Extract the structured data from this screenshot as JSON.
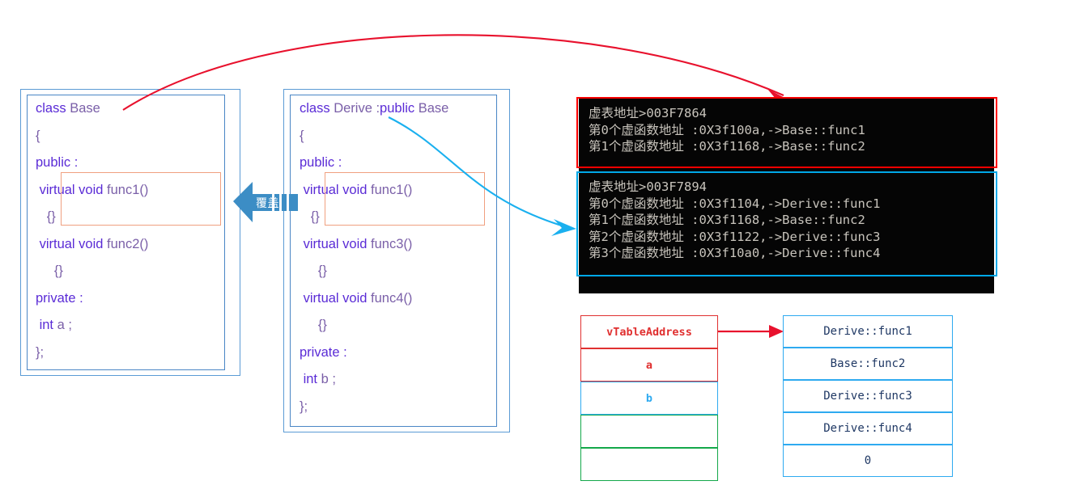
{
  "base_class": {
    "lines": [
      [
        {
          "t": "class ",
          "c": "kw"
        },
        {
          "t": "Base",
          "c": "id"
        }
      ],
      [
        {
          "t": "{",
          "c": "id"
        }
      ],
      [
        {
          "t": "public :",
          "c": "kw"
        }
      ],
      [
        {
          "t": " virtual void ",
          "c": "kw"
        },
        {
          "t": "func1()",
          "c": "id"
        }
      ],
      [
        {
          "t": "   {}",
          "c": "id"
        }
      ],
      [
        {
          "t": " virtual void ",
          "c": "kw"
        },
        {
          "t": "func2()",
          "c": "id"
        }
      ],
      [
        {
          "t": "     {}",
          "c": "id"
        }
      ],
      [
        {
          "t": "private :",
          "c": "kw"
        }
      ],
      [
        {
          "t": " int ",
          "c": "kw"
        },
        {
          "t": "a ;",
          "c": "id"
        }
      ],
      [
        {
          "t": "};",
          "c": "id"
        }
      ]
    ]
  },
  "derive_class": {
    "lines": [
      [
        {
          "t": "class ",
          "c": "kw"
        },
        {
          "t": "Derive :",
          "c": "id"
        },
        {
          "t": "public ",
          "c": "kw"
        },
        {
          "t": "Base",
          "c": "id"
        }
      ],
      [
        {
          "t": "{",
          "c": "id"
        }
      ],
      [
        {
          "t": "public :",
          "c": "kw"
        }
      ],
      [
        {
          "t": " virtual void ",
          "c": "kw"
        },
        {
          "t": "func1()",
          "c": "id"
        }
      ],
      [
        {
          "t": "   {}",
          "c": "id"
        }
      ],
      [
        {
          "t": " virtual void ",
          "c": "kw"
        },
        {
          "t": "func3()",
          "c": "id"
        }
      ],
      [
        {
          "t": "     {}",
          "c": "id"
        }
      ],
      [
        {
          "t": " virtual void ",
          "c": "kw"
        },
        {
          "t": "func4()",
          "c": "id"
        }
      ],
      [
        {
          "t": "     {}",
          "c": "id"
        }
      ],
      [
        {
          "t": "private :",
          "c": "kw"
        }
      ],
      [
        {
          "t": " int ",
          "c": "kw"
        },
        {
          "t": "b ;",
          "c": "id"
        }
      ],
      [
        {
          "t": "};",
          "c": "id"
        }
      ]
    ]
  },
  "override_arrow": {
    "label": "覆盖",
    "color": "#3c8dc5"
  },
  "console_base": {
    "border_color": "#ff0000",
    "lines": [
      "虚表地址>003F7864",
      "第0个虚函数地址 :0X3f100a,->Base::func1",
      "第1个虚函数地址 :0X3f1168,->Base::func2"
    ]
  },
  "console_derive": {
    "border_color": "#00a8e8",
    "lines": [
      "虚表地址>003F7894",
      "第0个虚函数地址 :0X3f1104,->Derive::func1",
      "第1个虚函数地址 :0X3f1168,->Base::func2",
      "第2个虚函数地址 :0X3f1122,->Derive::func3",
      "第3个虚函数地址 :0X3f10a0,->Derive::func4"
    ]
  },
  "object_layout": {
    "cells": [
      {
        "label": "vTableAddress",
        "color": "red"
      },
      {
        "label": "a",
        "color": "red"
      },
      {
        "label": "b",
        "color": "blue"
      },
      {
        "label": "",
        "color": "green"
      },
      {
        "label": "",
        "color": "green"
      }
    ]
  },
  "vtable": {
    "cells": [
      {
        "label": "Derive::func1"
      },
      {
        "label": "Base::func2"
      },
      {
        "label": "Derive::func3"
      },
      {
        "label": "Derive::func4"
      },
      {
        "label": "0"
      }
    ]
  },
  "colors": {
    "keyword": "#5a2bd6",
    "identifier": "#7a5fa8",
    "box_border": "#5b9bd5",
    "highlight": "#f0a080",
    "red_accent": "#ff0000",
    "cyan_accent": "#00a8e8",
    "green_accent": "#14a84a"
  }
}
